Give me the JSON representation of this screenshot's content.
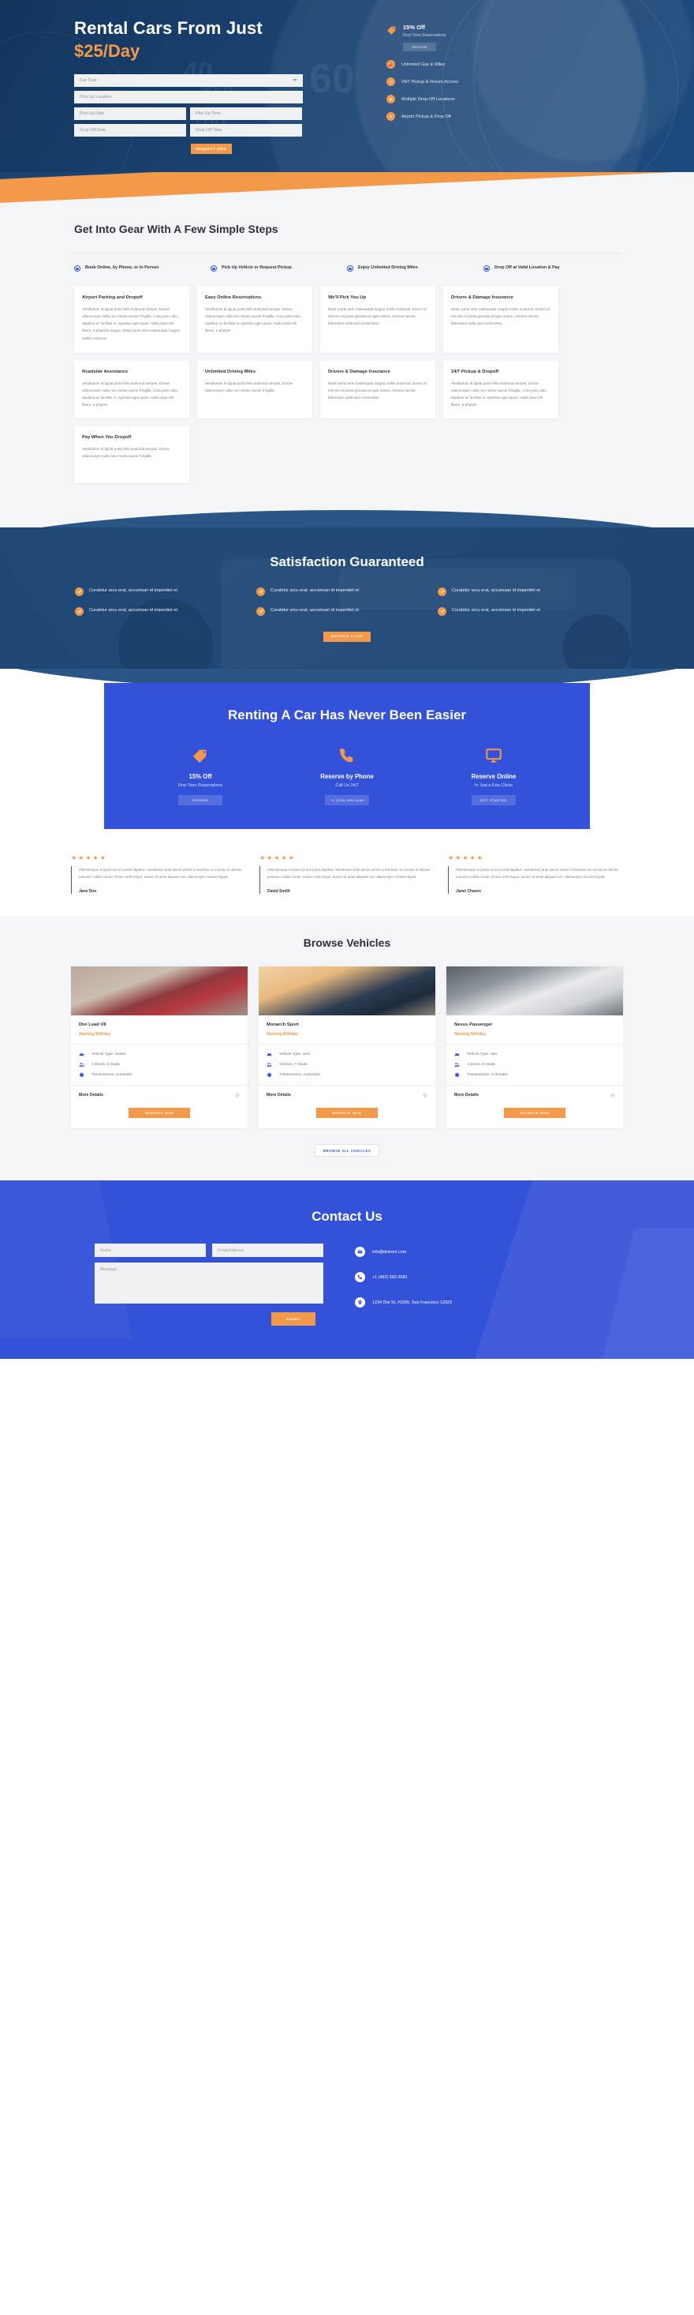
{
  "hero": {
    "title": "Rental Cars From Just",
    "price": "$25/Day",
    "form": {
      "car_type": "Car Type",
      "pickup_location": "Pick Up Location",
      "pickup_date": "Pick Up Date",
      "pickup_time": "Pick Up Time",
      "dropoff_date": "Drop Off Date",
      "dropoff_time": "Drop Off Time",
      "submit": "REQUEST NOW"
    },
    "promo": {
      "heading": "15% Off",
      "sub": "First Time Reservations",
      "button": "REDEEM"
    },
    "features": [
      "Unlimited Gas & Miles",
      "24/7 Pickup & Return Access",
      "Multiple Drop-Off Locations",
      "Airport Pickup & Drop Off"
    ]
  },
  "steps_section": {
    "heading": "Get Into Gear With A Few Simple Steps",
    "steps": [
      "Book Online, by Phone, or In Person",
      "Pick Up Vehicle or Request Pickup",
      "Enjoy Unlimited Driving Miles",
      "Drop Off at Valid Location & Pay"
    ],
    "cards": [
      {
        "title": "Airport Parking and Dropoff",
        "body": "Vestibulum id ligula porta felis euismod semper. Donec ullamcorper nulla non metus auctor fringilla. Cras justo odio, dapibus ac facilisis in, egestas eget quam. Nulla vitae elit libero, a pharetra augue. Etiam porta sem malesuada magna mollis euismod."
      },
      {
        "title": "Easy Online Reservations",
        "body": "Vestibulum id ligula porta felis euismod semper. Donec ullamcorper nulla non metus auctor fringilla. Cras justo odio, dapibus ac facilisis in, egestas eget quam. Nulla vitae elit libero, a pharetr"
      },
      {
        "title": "We'll Pick You Up",
        "body": "Etiam porta sem malesuada magna mollis euismod. Donec id elit non mi porta gravida at eget metus. Aenean lacinia bibendum nulla sed consectetur."
      },
      {
        "title": "Drivers & Damage Insurance",
        "body": "Etiam porta sem malesuada magna mollis euismod. Donec id elit non mi porta gravida at eget metus. Aenean lacinia bibendum nulla sed consectetur."
      },
      {
        "title": "Roadside Assistance",
        "body": "Vestibulum id ligula porta felis euismod semper. Donec ullamcorper nulla non metus auctor fringilla. Cras justo odio, dapibus ac facilisis in, egestas eget quam. Nulla vitae elit libero, a pharetr"
      },
      {
        "title": "Unlimited Driving Miles",
        "body": "Vestibulum id ligula porta felis euismod semper. Donec ullamcorper nulla non metus auctor fringilla."
      },
      {
        "title": "Drivers & Damage Insurance",
        "body": "Etiam porta sem malesuada magna mollis euismod. Donec id elit non mi porta gravida at eget metus. Aenean lacinia bibendum nulla sed consectetur."
      },
      {
        "title": "24/7 Pickup & Dropoff",
        "body": "Vestibulum id ligula porta felis euismod semper. Donec ullamcorper nulla non metus auctor fringilla. Cras justo odio, dapibus ac facilisis in, egestas eget quam. Nulla vitae elit libero, a pharetr"
      },
      {
        "title": "Pay When You Dropoff",
        "body": "Vestibulum id ligula porta felis euismod semper. Donec ullamcorper nulla non metus auctor fringilla."
      }
    ]
  },
  "satisfaction": {
    "heading": "Satisfaction Guaranteed",
    "items": [
      "Curabitur arcu erat, accumsan id imperdiet et",
      "Curabitur arcu erat, accumsan id imperdiet et",
      "Curabitur arcu erat, accumsan id imperdiet et",
      "Curabitur arcu erat, accumsan id imperdiet et",
      "Curabitur arcu erat, accumsan id imperdiet et",
      "Curabitur arcu erat, accumsan id imperdiet et"
    ],
    "button": "RESERVE A CAR"
  },
  "renting": {
    "heading": "Renting A Car Has Never Been Easier",
    "columns": [
      {
        "icon": "tag-icon",
        "title": "15% Off",
        "sub": "First Time Reservations",
        "button": "REDEEM"
      },
      {
        "icon": "phone-icon",
        "title": "Reserve by Phone",
        "sub": "Call Us 24/7",
        "button": "+1 (235) 596-3496"
      },
      {
        "icon": "monitor-icon",
        "title": "Reserve Online",
        "sub": "In Just a Few Clicks",
        "button": "GET STARTED"
      }
    ]
  },
  "testimonials": [
    {
      "stars": "★★★★★",
      "quote": "Pellentesque in ipsum id orci porta dapibus. Vestibulum ante ipsum primis in faucibus orci luctus et ultrices posuere cubilia Curae; Donec velit neque, auctor sit amet aliquam vel, ullamcorper sit amet ligula.",
      "name": "Jane Doe"
    },
    {
      "stars": "★★★★★",
      "quote": "Pellentesque in ipsum id orci porta dapibus. Vestibulum ante ipsum primis in faucibus orci luctus et ultrices posuere cubilia Curae; Donec velit neque, auctor sit amet aliquam vel, ullamcorper sit amet ligula.",
      "name": "David Smith"
    },
    {
      "stars": "★★★★★",
      "quote": "Pellentesque in ipsum id orci porta dapibus. Vestibulum ante ipsum primis in faucibus orci luctus et ultrices posuere cubilia Curae; Donec velit neque, auctor sit amet aliquam vel, ullamcorper sit amet ligula.",
      "name": "Janet Chavez"
    }
  ],
  "vehicles_section": {
    "heading": "Browse Vehicles",
    "more_details_label": "More Details",
    "reserve_label": "RESERVE NOW",
    "browse_all_label": "BROWSE ALL VEHICLES",
    "vehicles": [
      {
        "name": "Divi Lead V8",
        "price": "Starting $44/day",
        "specs": [
          "Vehicle Type: Sedan",
          "4 Doors, 5 Seats",
          "Transmission: Automatic"
        ]
      },
      {
        "name": "Monarch Sport",
        "price": "Starting $44/day",
        "specs": [
          "Vehicle Type: SUV",
          "4 Doors, 7 Seats",
          "Transmission: Automatic"
        ]
      },
      {
        "name": "Nexus Passenger",
        "price": "Starting $44/day",
        "specs": [
          "Vehicle Type: Van",
          "4 Doors, 8 Seats",
          "Transmission: Automatic"
        ]
      }
    ]
  },
  "contact": {
    "heading": "Contact Us",
    "name_placeholder": "Name",
    "email_placeholder": "Email Address",
    "message_placeholder": "Message",
    "submit_label": "SUBMIT",
    "info": [
      {
        "icon": "envelope-icon",
        "text": "info@divirent.com"
      },
      {
        "icon": "phone-icon",
        "text": "+1 (462) 583-3582"
      },
      {
        "icon": "map-pin-icon",
        "text": "1234 Divi St. #1000, San Francisco 12923"
      }
    ]
  },
  "colors": {
    "navy": "#1b4473",
    "blue": "#3351d9",
    "orange": "#f2994a",
    "light": "#f4f5f7"
  }
}
